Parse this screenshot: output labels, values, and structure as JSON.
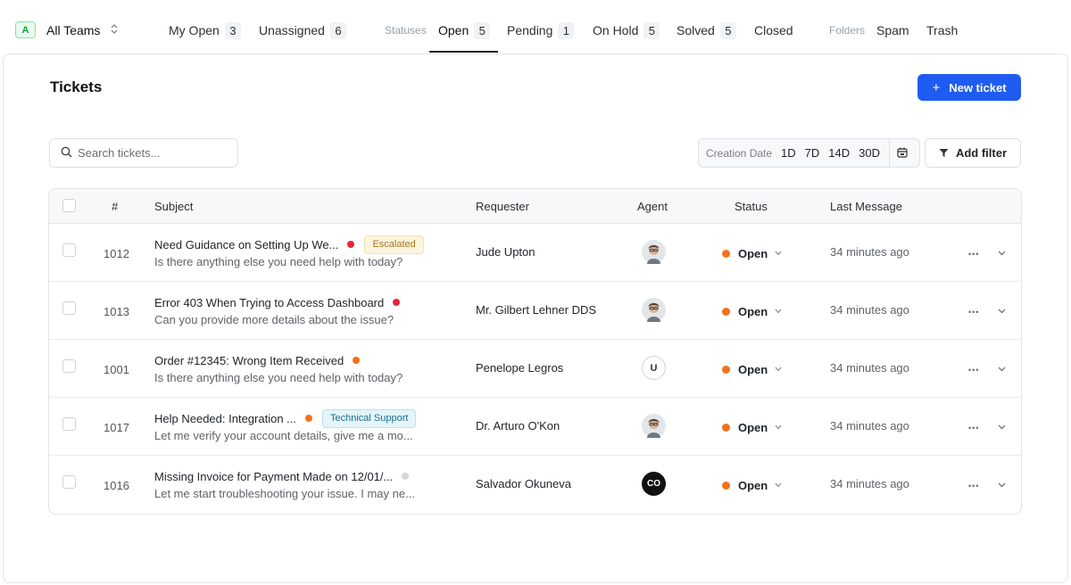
{
  "team": {
    "badge": "A",
    "name": "All Teams",
    "chevron": "⌃⌄"
  },
  "nav": {
    "my_open": {
      "label": "My Open",
      "count": "3"
    },
    "unassigned": {
      "label": "Unassigned",
      "count": "6"
    },
    "statuses_label": "Statuses",
    "statuses": [
      {
        "label": "Open",
        "count": "5"
      },
      {
        "label": "Pending",
        "count": "1"
      },
      {
        "label": "On Hold",
        "count": "5"
      },
      {
        "label": "Solved",
        "count": "5"
      },
      {
        "label": "Closed",
        "count": ""
      }
    ],
    "folders_label": "Folders",
    "folders": [
      "Spam",
      "Trash"
    ],
    "active_tab": "Open"
  },
  "page": {
    "title": "Tickets",
    "new_ticket_label": "New ticket"
  },
  "search": {
    "placeholder": "Search tickets..."
  },
  "date_filter": {
    "label": "Creation Date",
    "options": [
      "1D",
      "7D",
      "14D",
      "30D"
    ]
  },
  "add_filter_label": "Add filter",
  "table": {
    "headers": {
      "num": "#",
      "subject": "Subject",
      "requester": "Requester",
      "agent": "Agent",
      "status": "Status",
      "last_message": "Last Message"
    },
    "rows": [
      {
        "id": "1012",
        "subject": "Need Guidance on Setting Up We...",
        "priority_color": "#e8253b",
        "tag": "Escalated",
        "preview": "Is there anything else you need help with today?",
        "requester": "Jude Upton",
        "agent": "photo",
        "status": "Open",
        "last_message": "34 minutes ago"
      },
      {
        "id": "1013",
        "subject": "Error 403 When Trying to Access Dashboard",
        "priority_color": "#e8253b",
        "tag": "",
        "preview": "Can you provide more details about the issue?",
        "requester": "Mr. Gilbert Lehner DDS",
        "agent": "photo",
        "status": "Open",
        "last_message": "34 minutes ago"
      },
      {
        "id": "1001",
        "subject": "Order #12345: Wrong Item Received",
        "priority_color": "#f2711c",
        "tag": "",
        "preview": "Is there anything else you need help with today?",
        "requester": "Penelope Legros",
        "agent": "U",
        "status": "Open",
        "last_message": "34 minutes ago"
      },
      {
        "id": "1017",
        "subject": "Help Needed: Integration ...",
        "priority_color": "#f2711c",
        "tag": "Technical Support",
        "preview": "Let me verify your account details, give me a mo...",
        "requester": "Dr. Arturo O'Kon",
        "agent": "photo",
        "status": "Open",
        "last_message": "34 minutes ago"
      },
      {
        "id": "1016",
        "subject": "Missing Invoice for Payment Made on 12/01/...",
        "priority_color": "#d4d6d9",
        "tag": "",
        "preview": "Let me start troubleshooting your issue. I may ne...",
        "requester": "Salvador Okuneva",
        "agent": "CO",
        "status": "Open",
        "last_message": "34 minutes ago"
      }
    ]
  },
  "colors": {
    "primary": "#1e5bf0",
    "status_open": "#f2711c",
    "priority_high": "#e8253b",
    "priority_medium": "#f2711c",
    "priority_low": "#d4d6d9"
  }
}
